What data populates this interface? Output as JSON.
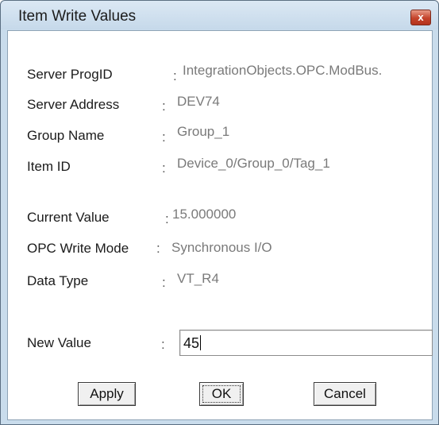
{
  "window": {
    "title": "Item Write Values",
    "close_glyph": "x"
  },
  "fields": {
    "server_progid": {
      "label": "Server ProgID",
      "colon": ":",
      "value": "IntegrationObjects.OPC.ModBus."
    },
    "server_address": {
      "label": "Server Address",
      "colon": ":",
      "value": "DEV74"
    },
    "group_name": {
      "label": "Group Name",
      "colon": ":",
      "value": "Group_1"
    },
    "item_id": {
      "label": "Item ID",
      "colon": ":",
      "value": "Device_0/Group_0/Tag_1"
    },
    "current_value": {
      "label": "Current Value",
      "colon": ":",
      "value": "15.000000"
    },
    "opc_write_mode": {
      "label": "OPC Write Mode",
      "colon": ":",
      "value": "Synchronous I/O"
    },
    "data_type": {
      "label": "Data Type",
      "colon": ":",
      "value": "VT_R4"
    }
  },
  "new_value": {
    "label": "New Value",
    "colon": ":",
    "value": "45"
  },
  "buttons": {
    "apply": "Apply",
    "ok": "OK",
    "cancel": "Cancel"
  },
  "colors": {
    "frame": "#c9dcec",
    "close_button": "#c4432b",
    "value_text": "#7a7a7a"
  }
}
